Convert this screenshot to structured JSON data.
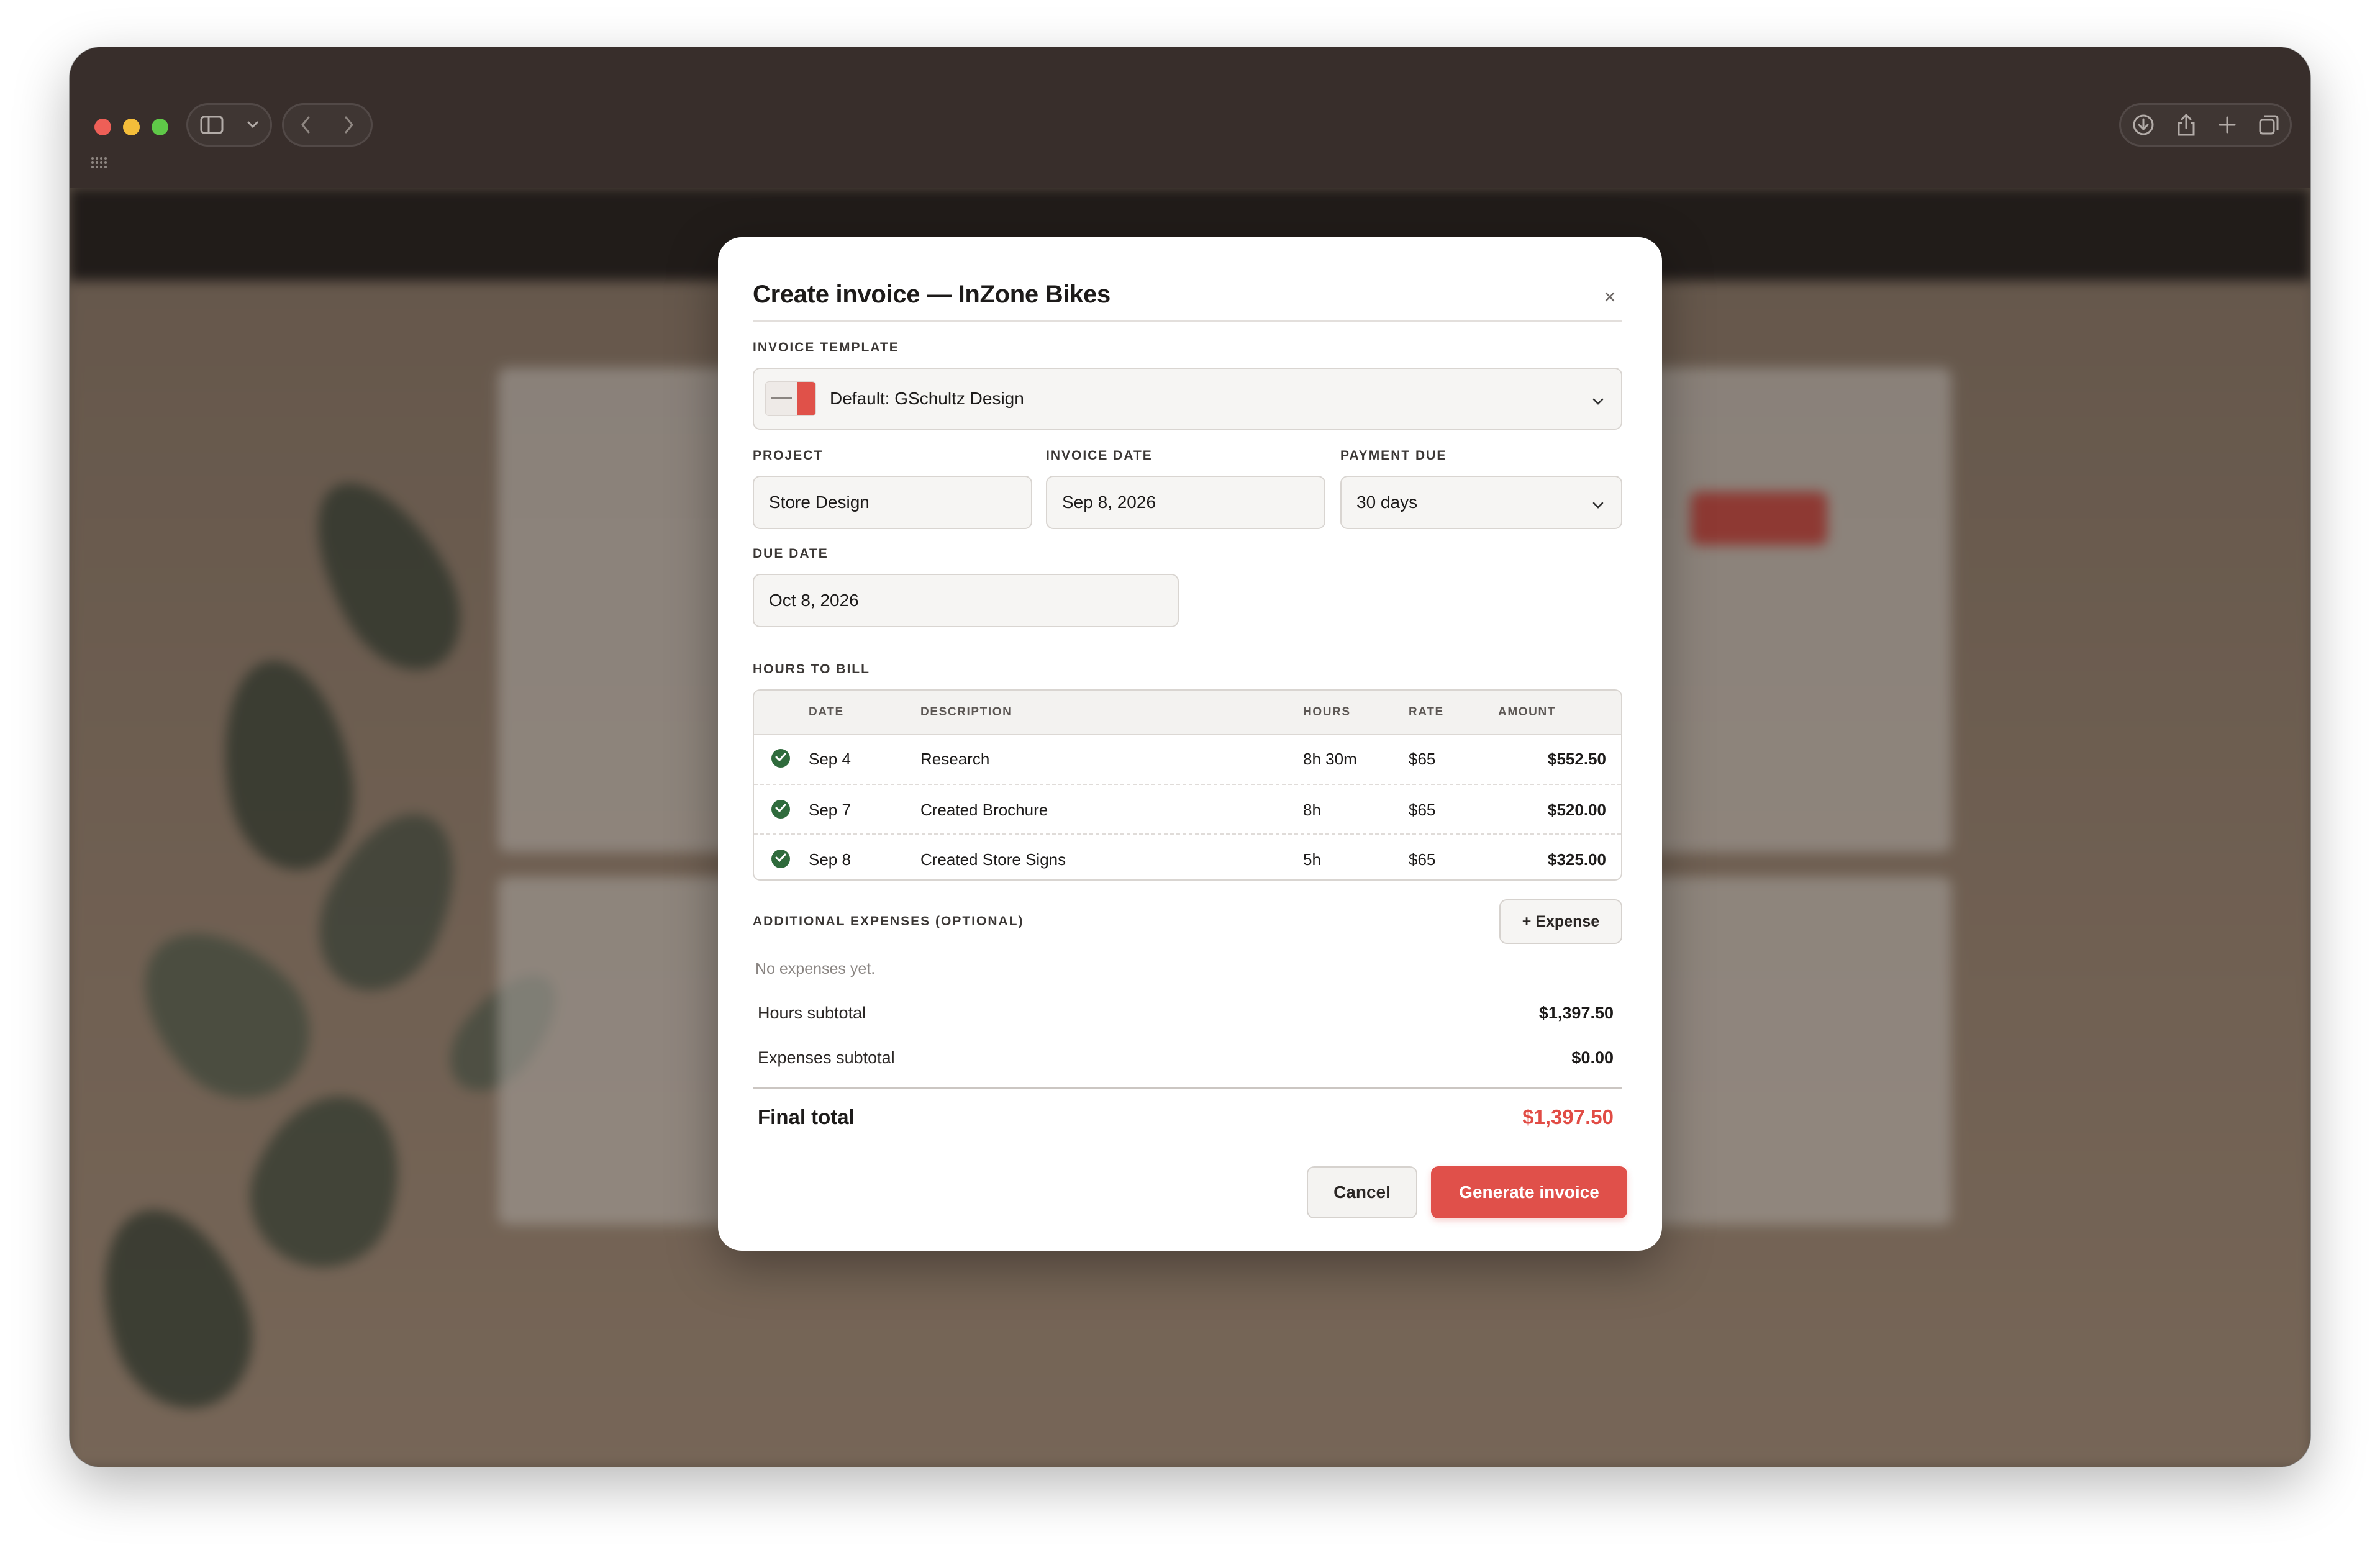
{
  "modal": {
    "title": "Create invoice — InZone Bikes",
    "invoice_template": {
      "label": "INVOICE TEMPLATE",
      "value": "Default: GSchultz Design"
    },
    "project": {
      "label": "PROJECT",
      "value": "Store Design"
    },
    "invoice_date": {
      "label": "INVOICE DATE",
      "value": "Sep 8, 2026"
    },
    "payment_due": {
      "label": "PAYMENT DUE",
      "value": "30 days"
    },
    "due_date": {
      "label": "DUE DATE",
      "value": "Oct 8, 2026"
    },
    "hours_to_bill": {
      "label": "HOURS TO BILL",
      "columns": [
        "DATE",
        "DESCRIPTION",
        "HOURS",
        "RATE",
        "AMOUNT"
      ],
      "rows": [
        {
          "checked": true,
          "date": "Sep 4",
          "description": "Research",
          "hours": "8h 30m",
          "rate": "$65",
          "amount": "$552.50"
        },
        {
          "checked": true,
          "date": "Sep 7",
          "description": "Created Brochure",
          "hours": "8h",
          "rate": "$65",
          "amount": "$520.00"
        },
        {
          "checked": true,
          "date": "Sep 8",
          "description": "Created Store Signs",
          "hours": "5h",
          "rate": "$65",
          "amount": "$325.00"
        }
      ]
    },
    "expenses": {
      "label": "ADDITIONAL EXPENSES (OPTIONAL)",
      "add_button": "+ Expense",
      "empty_text": "No expenses yet."
    },
    "summary": {
      "hours_subtotal_label": "Hours subtotal",
      "hours_subtotal": "$1,397.50",
      "expenses_subtotal_label": "Expenses subtotal",
      "expenses_subtotal": "$0.00",
      "final_total_label": "Final total",
      "final_total": "$1,397.50"
    },
    "actions": {
      "cancel": "Cancel",
      "generate": "Generate invoice"
    }
  },
  "browser": {
    "icons": [
      "sidebar-icon",
      "chevron-down-icon",
      "back-icon",
      "forward-icon",
      "download-icon",
      "share-icon",
      "new-tab-icon",
      "tabs-overview-icon"
    ]
  },
  "colors": {
    "accent": "#e0504a",
    "check_green": "#2f6b3c",
    "window_chrome": "#382e2b"
  }
}
